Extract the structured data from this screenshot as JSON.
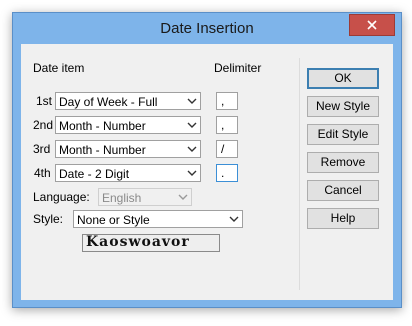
{
  "window": {
    "title": "Date Insertion"
  },
  "labels": {
    "date_item": "Date item",
    "delimiter": "Delimiter",
    "language": "Language:",
    "style": "Style:"
  },
  "rows": [
    {
      "ordinal": "1st",
      "value": "Day of Week - Full",
      "delimiter": ","
    },
    {
      "ordinal": "2nd",
      "value": "Month - Number",
      "delimiter": ","
    },
    {
      "ordinal": "3rd",
      "value": "Month - Number",
      "delimiter": "/"
    },
    {
      "ordinal": "4th",
      "value": "Date - 2 Digit",
      "delimiter": "."
    }
  ],
  "language": {
    "value": "English",
    "disabled": true
  },
  "style": {
    "value": "None or Style"
  },
  "sample_text": "Kaoswoavor",
  "buttons": {
    "ok": "OK",
    "new_style": "New Style",
    "edit_style": "Edit Style",
    "remove": "Remove",
    "cancel": "Cancel",
    "help": "Help"
  },
  "colors": {
    "titlebar": "#7eb4ea",
    "close_button": "#c7504a",
    "dialog_background": "#f0f0f0",
    "focus_border": "#3c8fd6"
  },
  "icons": {
    "close": "close-icon",
    "dropdown": "chevron-down-icon"
  }
}
